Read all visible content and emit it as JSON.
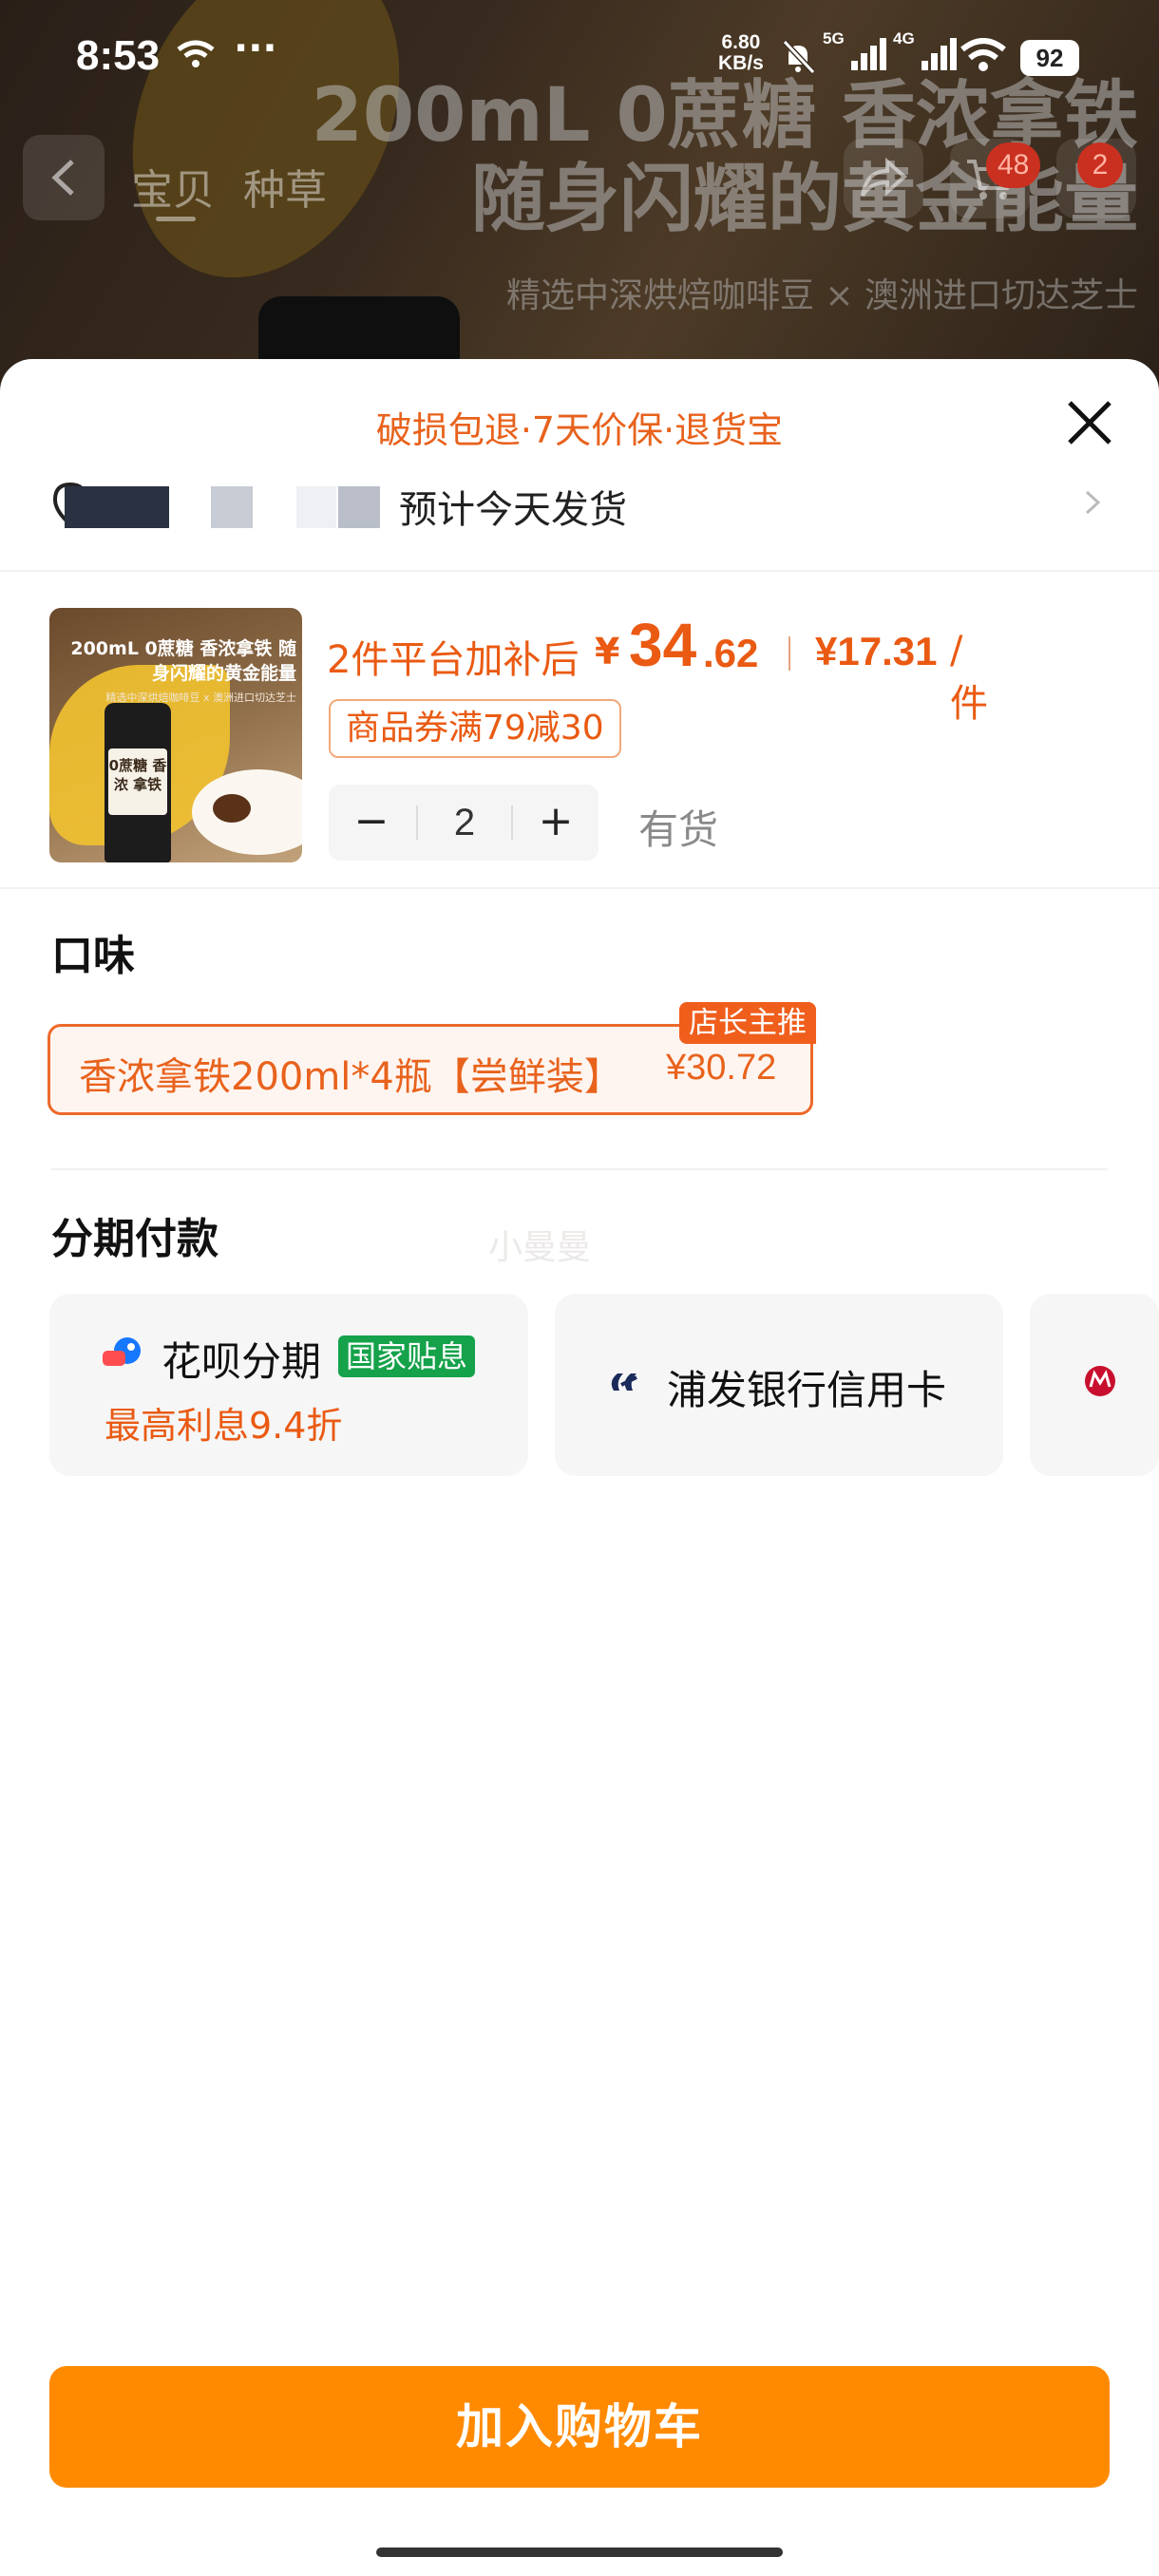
{
  "status_bar": {
    "time": "8:53",
    "dots": "···",
    "net_speed_value": "6.80",
    "net_speed_unit": "KB/s",
    "sim1": "5G",
    "sim2": "4G",
    "battery": "92"
  },
  "product_header": {
    "banner_line1": "200mL 0蔗糖 香浓拿铁",
    "banner_line2": "随身闪耀的黄金能量",
    "banner_sub": "精选中深烘焙咖啡豆 × 澳洲进口切达芝士",
    "tabs": [
      {
        "label": "宝贝"
      },
      {
        "label": "种草"
      }
    ],
    "cart_count": "48",
    "msg_count": "2"
  },
  "sheet": {
    "guarantee": "破损包退·7天价保·退货宝",
    "shipping": "预计今天发货",
    "product": {
      "thumb_title": "200mL 0蔗糖 香浓拿铁 随身闪耀的黄金能量",
      "thumb_sub": "精选中深烘焙咖啡豆 x 澳洲进口切达芝士",
      "thumb_label": "0蔗糖 香浓 拿铁",
      "price_prefix": "2件平台加补后",
      "price_yen": "¥",
      "price_int": "34",
      "price_dec": ".62",
      "unit_price": "¥17.31",
      "unit_suffix": "/件",
      "coupon": "商品券满79减30"
    },
    "quantity": {
      "minus": "−",
      "value": "2",
      "plus": "+",
      "stock": "有货"
    },
    "flavor": {
      "title": "口味",
      "option_name": "香浓拿铁200ml*4瓶【尝鲜装】",
      "option_price": "¥30.72",
      "option_badge": "店长主推"
    },
    "installment": {
      "title": "分期付款",
      "watermark": "小曼曼",
      "huabei_label": "花呗分期",
      "subsidy": "国家贴息",
      "huabei_rate": "最高利息9.4折",
      "pufa_label": "浦发银行信用卡"
    },
    "add_to_cart": "加入购物车"
  },
  "colors": {
    "accent_orange": "#ff8a00",
    "price_orange": "#ea5a12",
    "subsidy_green": "#15a24a"
  }
}
